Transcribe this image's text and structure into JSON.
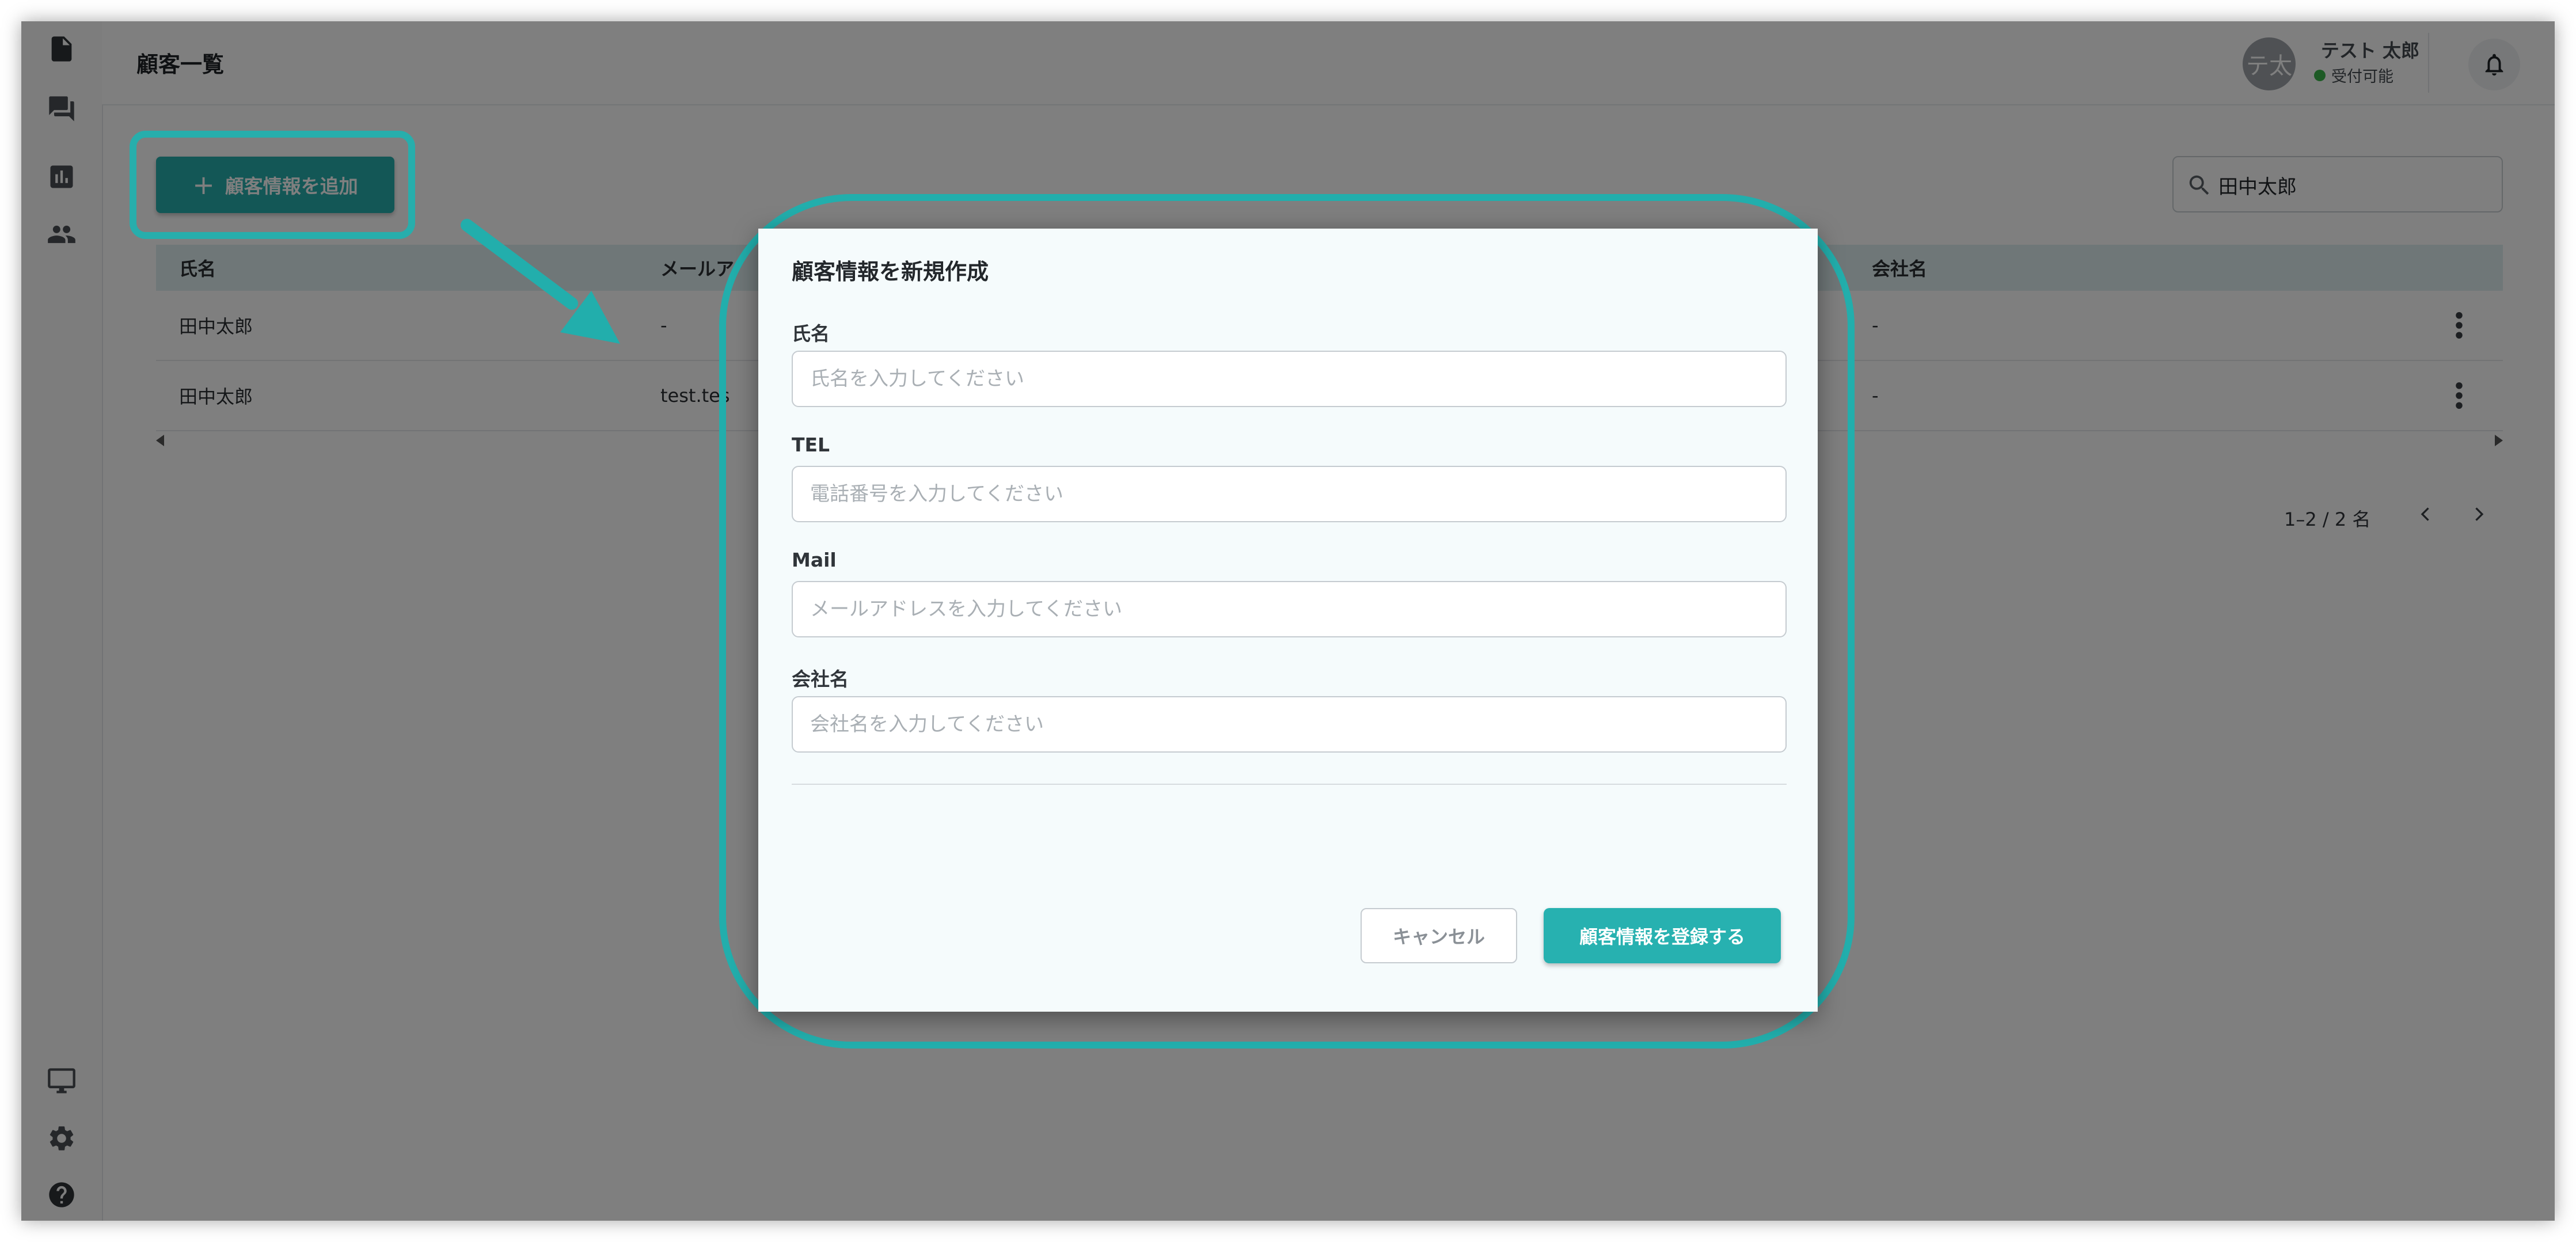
{
  "header": {
    "page_title": "顧客一覧",
    "user": {
      "avatar_text": "テ太",
      "name": "テスト 太郎",
      "status": "受付可能"
    }
  },
  "sidebar": {
    "items": [
      {
        "icon": "document-icon"
      },
      {
        "icon": "chat-icon"
      },
      {
        "icon": "chart-icon"
      },
      {
        "icon": "people-icon"
      },
      {
        "icon": "monitor-icon"
      },
      {
        "icon": "gear-icon"
      },
      {
        "icon": "help-icon"
      }
    ]
  },
  "toolbar": {
    "add_label": "顧客情報を追加"
  },
  "search": {
    "value": "田中太郎"
  },
  "table": {
    "columns": {
      "name": "氏名",
      "mail": "メールア",
      "company": "会社名"
    },
    "rows": [
      {
        "name": "田中太郎",
        "mail": "-",
        "company": "-"
      },
      {
        "name": "田中太郎",
        "mail": "test.tes",
        "company": "-"
      }
    ]
  },
  "pagination": {
    "text": "1–2 / 2 名"
  },
  "dialog": {
    "title": "顧客情報を新規作成",
    "fields": [
      {
        "label": "氏名",
        "placeholder": "氏名を入力してください",
        "value": ""
      },
      {
        "label": "TEL",
        "placeholder": "電話番号を入力してください",
        "value": ""
      },
      {
        "label": "Mail",
        "placeholder": "メールアドレスを入力してください",
        "value": ""
      },
      {
        "label": "会社名",
        "placeholder": "会社名を入力してください",
        "value": ""
      }
    ],
    "cancel_label": "キャンセル",
    "submit_label": "顧客情報を登録する"
  },
  "colors": {
    "accent": "#27aeac",
    "highlight": "#22aeac",
    "table_header_bg": "#dfeff0",
    "status_available": "#3bb54a"
  }
}
